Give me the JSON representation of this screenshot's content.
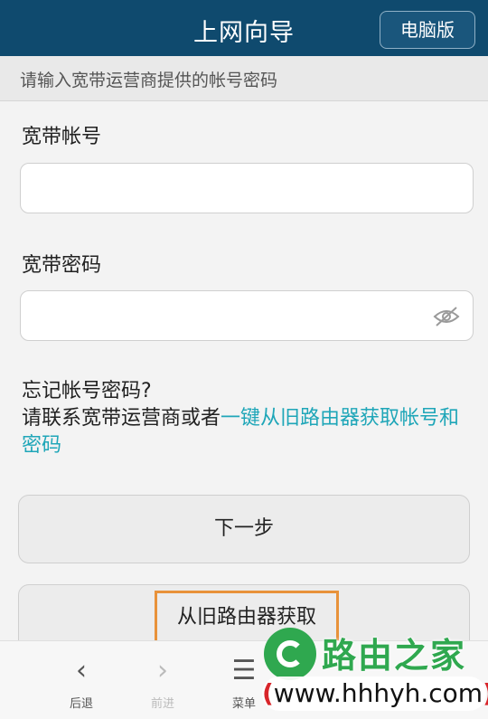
{
  "header": {
    "title": "上网向导",
    "pc_button": "电脑版"
  },
  "hint": "请输入宽带运营商提供的帐号密码",
  "account": {
    "label": "宽带帐号",
    "value": ""
  },
  "password": {
    "label": "宽带密码",
    "value": ""
  },
  "forgot": {
    "question": "忘记帐号密码?",
    "prefix": "请联系宽带运营商或者",
    "link": "一键从旧路由器获取帐号和密码"
  },
  "buttons": {
    "next": "下一步",
    "from_old": "从旧路由器获取"
  },
  "bottom_nav": [
    {
      "icon": "back-icon",
      "label": "后退"
    },
    {
      "icon": "forward-icon",
      "label": "前进"
    },
    {
      "icon": "menu-icon",
      "label": "菜单"
    }
  ],
  "watermark": {
    "brand": "路由之家",
    "url": "www.hhhyh.com",
    "paren_open": "(",
    "paren_close": ")"
  }
}
